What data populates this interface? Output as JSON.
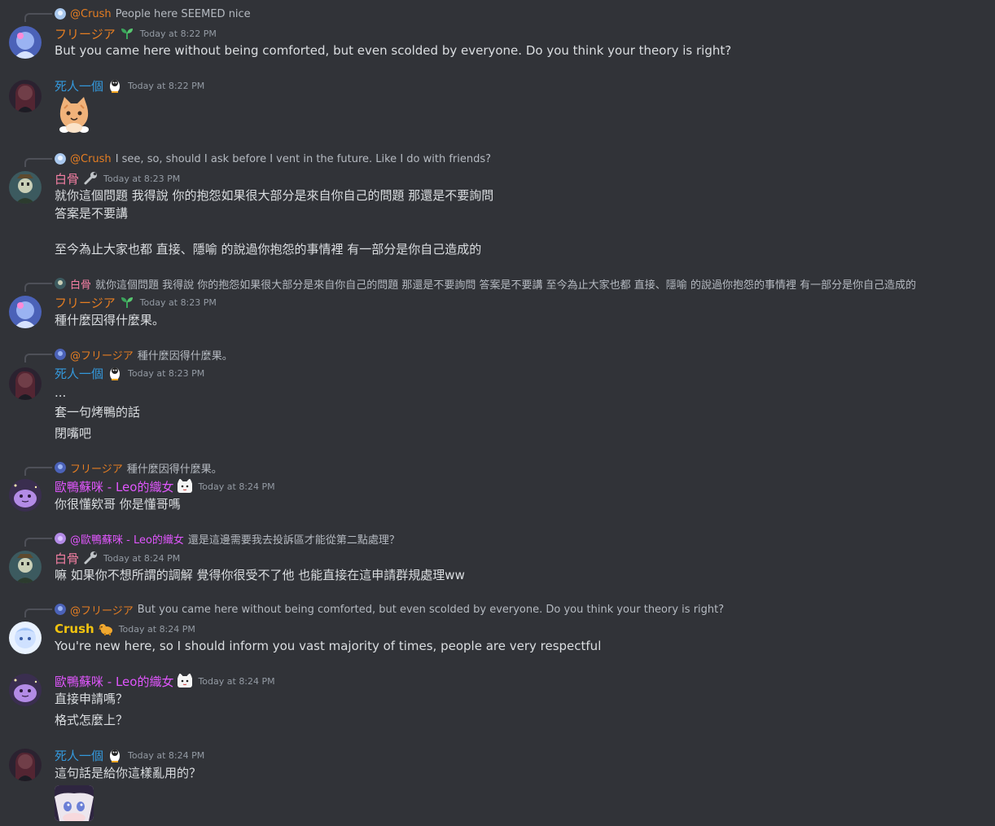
{
  "messages": [
    {
      "reply": {
        "name": "@Crush",
        "text": "People here SEEMED nice"
      },
      "author": "フリージア",
      "time": "Today at 8:22 PM",
      "lines": [
        "But you came here without being comforted, but even scolded by everyone. Do you think your theory is right?"
      ]
    },
    {
      "author": "死人一個",
      "time": "Today at 8:22 PM",
      "lines": []
    },
    {
      "reply": {
        "name": "@Crush",
        "text": "I see, so, should I ask before I vent in the future. Like I do with friends?"
      },
      "author": "白骨",
      "time": "Today at 8:23 PM",
      "lines": [
        "就你這個問題 我得說 你的抱怨如果很大部分是來自你自己的問題 那還是不要詢問",
        "答案是不要講",
        "至今為止大家也都 直接、隱喻 的說過你抱怨的事情裡 有一部分是你自己造成的"
      ]
    },
    {
      "reply": {
        "name": "白骨",
        "text": "就你這個問題 我得說 你的抱怨如果很大部分是來自你自己的問題 那還是不要詢問  答案是不要講  至今為止大家也都 直接、隱喻 的說過你抱怨的事情裡 有一部分是你自己造成的"
      },
      "author": "フリージア",
      "time": "Today at 8:23 PM",
      "lines": [
        "種什麼因得什麼果。"
      ]
    },
    {
      "reply": {
        "name": "@フリージア",
        "text": "種什麼因得什麼果。"
      },
      "author": "死人一個",
      "time": "Today at 8:23 PM",
      "lines": [
        "...",
        "套一句烤鴨的話",
        "閉嘴吧"
      ]
    },
    {
      "reply": {
        "name": "フリージア",
        "text": "種什麼因得什麼果。"
      },
      "author": "歐鴨蘇咪 - Leo的織女",
      "time": "Today at 8:24 PM",
      "lines": [
        "你很懂欸哥 你是懂哥嗎"
      ]
    },
    {
      "reply": {
        "name": "@歐鴨蘇咪 - Leo的織女",
        "text": "還是這邊需要我去投訴區才能從第二點處理？"
      },
      "author": "白骨",
      "time": "Today at 8:24 PM",
      "lines": [
        "嘛 如果你不想所謂的調解 覺得你很受不了他 也能直接在這申請群規處理ww"
      ]
    },
    {
      "reply": {
        "name": "@フリージア",
        "text": "But you came here without being comforted, but even scolded by everyone. Do you think your theory is right?"
      },
      "author": "Crush",
      "time": "Today at 8:24 PM",
      "lines": [
        "You're new here, so I should inform you vast majority of times, people are very respectful"
      ]
    },
    {
      "author": "歐鴨蘇咪 - Leo的織女",
      "time": "Today at 8:24 PM",
      "lines": [
        "直接申請嗎？",
        "格式怎麼上？"
      ]
    },
    {
      "author": "死人一個",
      "time": "Today at 8:24 PM",
      "lines": [
        "這句話是給你這樣亂用的？"
      ]
    }
  ],
  "icons": {
    "badge_flower": "sprout-icon",
    "badge_penguin": "penguin-icon",
    "badge_wrench": "wrench-icon",
    "badge_dog": "dog-icon",
    "badge_cat": "cat-face-icon"
  },
  "colors": {
    "background": "#313338",
    "text": "#dbdee1",
    "timestamp": "#949ba4",
    "name_orange": "#e67e22",
    "name_blue": "#3498db",
    "name_pink": "#f47fa3",
    "name_purple": "#e056fd",
    "name_gold": "#f1c40f"
  }
}
